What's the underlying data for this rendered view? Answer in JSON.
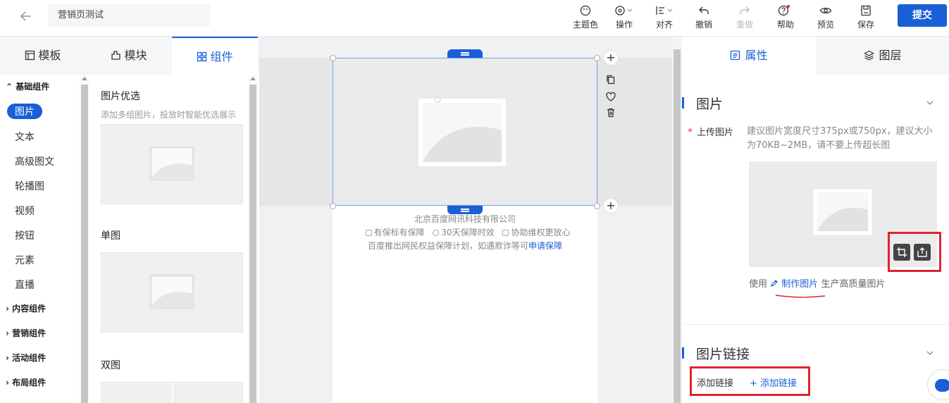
{
  "header": {
    "page_name": "营销页测试",
    "tools": [
      {
        "label": "主题色",
        "icon": "palette-icon"
      },
      {
        "label": "操作",
        "icon": "gear-icon"
      },
      {
        "label": "对齐",
        "icon": "align-icon"
      },
      {
        "label": "撤销",
        "icon": "undo-icon"
      },
      {
        "label": "重做",
        "icon": "redo-icon"
      },
      {
        "label": "帮助",
        "icon": "help-icon"
      },
      {
        "label": "预览",
        "icon": "eye-icon"
      },
      {
        "label": "保存",
        "icon": "save-icon"
      }
    ],
    "submit_label": "提交"
  },
  "left_tabs": [
    "模板",
    "模块",
    "组件"
  ],
  "categories": {
    "basic_group": "基础组件",
    "basic_items": [
      "图片",
      "文本",
      "高级图文",
      "轮播图",
      "视频",
      "按钮",
      "元素",
      "直播"
    ],
    "groups": [
      "内容组件",
      "营销组件",
      "活动组件",
      "布局组件"
    ]
  },
  "components": [
    {
      "title": "图片优选",
      "desc": "添加多组图片，投放时智能优选展示"
    },
    {
      "title": "单图",
      "desc": ""
    },
    {
      "title": "双图",
      "desc": ""
    }
  ],
  "canvas": {
    "company": "北京百度网讯科技有限公司",
    "badges": [
      "有保标有保障",
      "30天保障时效",
      "协助维权更放心"
    ],
    "notice": "百度推出网民权益保障计划，如遇欺诈等可",
    "notice_link": "申请保障"
  },
  "right_tabs": [
    "属性",
    "图层"
  ],
  "image_section": {
    "title": "图片",
    "upload_label": "上传图片",
    "hint": "建议图片宽度尺寸375px或750px，建议大小为70KB~2MB，请不要上传超长图",
    "make_prefix": "使用",
    "make_link": "制作图片",
    "make_suffix": "生产高质量图片"
  },
  "link_section": {
    "title": "图片链接",
    "label": "添加链接",
    "button": "+ 添加链接"
  },
  "colors": {
    "accent": "#1a5fd6",
    "highlight": "#e0242e"
  }
}
